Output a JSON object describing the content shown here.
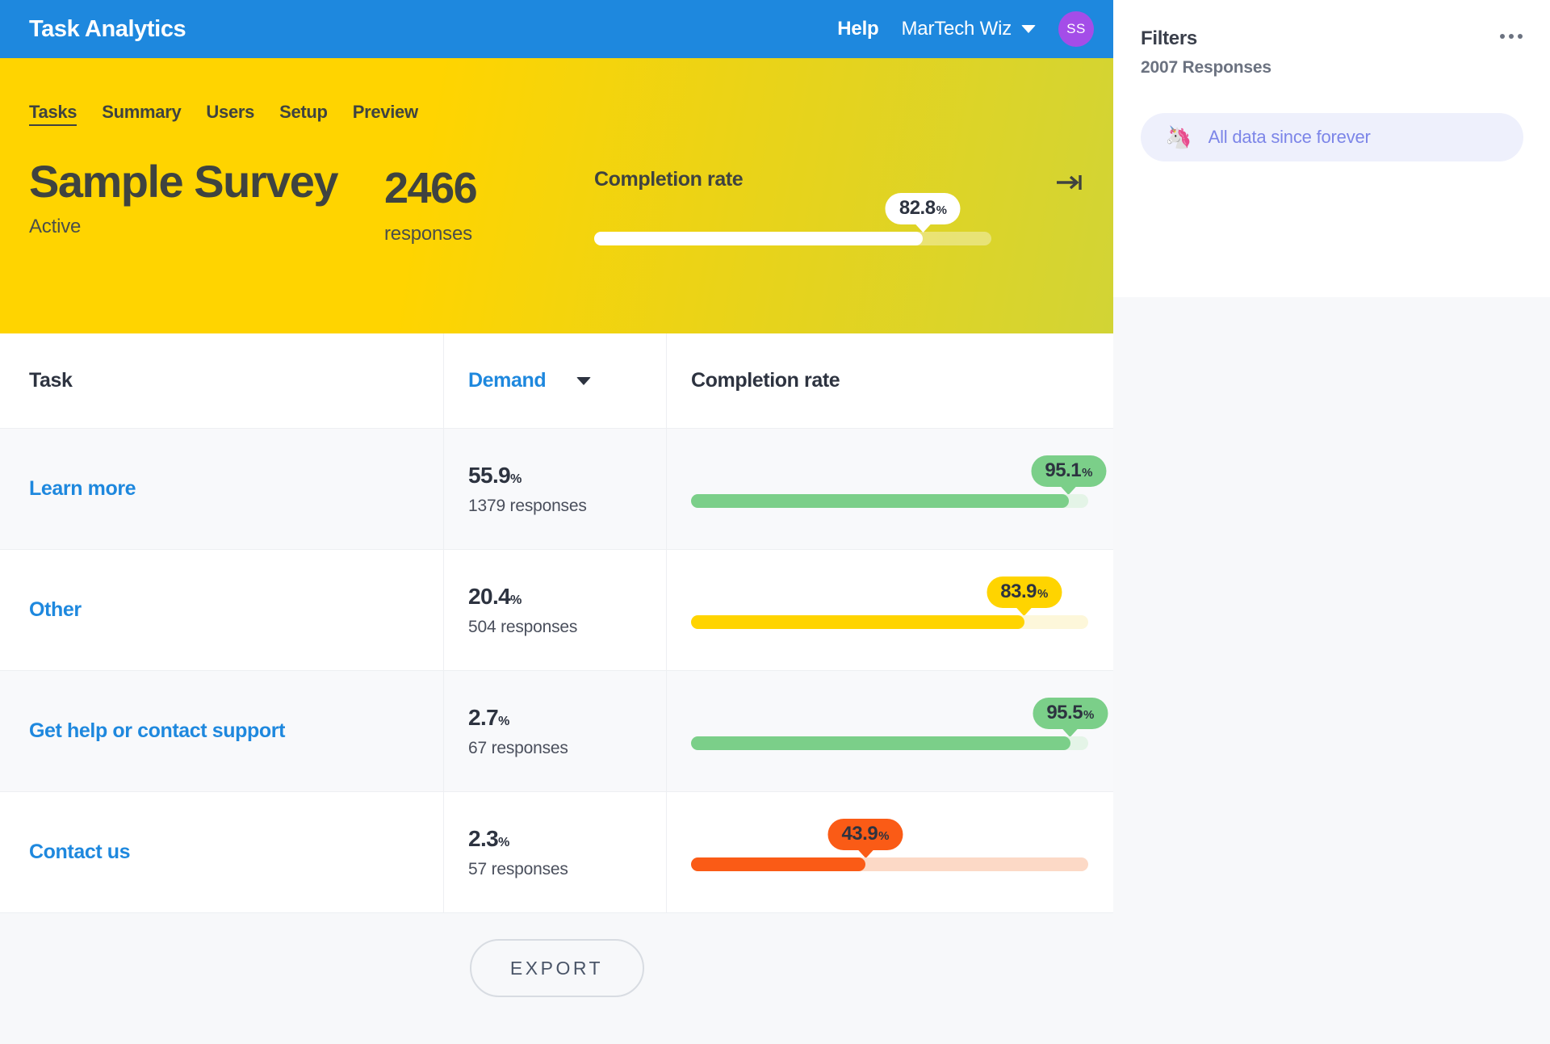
{
  "topbar": {
    "brand": "Task Analytics",
    "help_label": "Help",
    "account_name": "MarTech Wiz",
    "avatar_initials": "SS",
    "chevron_icon": "chevron-down-icon",
    "bg_color": "#1E88DE",
    "avatar_color": "#A44DE8"
  },
  "hero": {
    "tabs": [
      {
        "label": "Tasks",
        "active": true
      },
      {
        "label": "Summary",
        "active": false
      },
      {
        "label": "Users",
        "active": false
      },
      {
        "label": "Setup",
        "active": false
      },
      {
        "label": "Preview",
        "active": false
      }
    ],
    "collapse_icon": "arrow-to-end-icon",
    "title": "Sample Survey",
    "status": "Active",
    "count": "2466",
    "count_label": "responses",
    "completion_rate_label": "Completion rate",
    "completion_rate_value": 82.8,
    "completion_rate_num": "82.8",
    "completion_rate_pct": "%",
    "gradient_from": "#FFD400",
    "gradient_to": "#D2D435"
  },
  "table": {
    "headers": {
      "task": "Task",
      "demand": "Demand",
      "completion_rate": "Completion rate"
    },
    "sort_chevron_icon": "chevron-down-icon",
    "rows": [
      {
        "task": "Learn more",
        "demand_num": "55.9",
        "demand_pct": "%",
        "demand_value": 55.9,
        "responses": "1379 responses",
        "responses_count": 1379,
        "completion_num": "95.1",
        "completion_pct": "%",
        "completion_value": 95.1,
        "color": "#7BCF89",
        "track_color": "#E4F4E7"
      },
      {
        "task": "Other",
        "demand_num": "20.4",
        "demand_pct": "%",
        "demand_value": 20.4,
        "responses": "504 responses",
        "responses_count": 504,
        "completion_num": "83.9",
        "completion_pct": "%",
        "completion_value": 83.9,
        "color": "#FFD400",
        "track_color": "#FDF7DA"
      },
      {
        "task": "Get help or contact support",
        "demand_num": "2.7",
        "demand_pct": "%",
        "demand_value": 2.7,
        "responses": "67 responses",
        "responses_count": 67,
        "completion_num": "95.5",
        "completion_pct": "%",
        "completion_value": 95.5,
        "color": "#7BCF89",
        "track_color": "#E4F4E7"
      },
      {
        "task": "Contact us",
        "demand_num": "2.3",
        "demand_pct": "%",
        "demand_value": 2.3,
        "responses": "57 responses",
        "responses_count": 57,
        "completion_num": "43.9",
        "completion_pct": "%",
        "completion_value": 43.9,
        "color": "#FA5B16",
        "track_color": "#FCD9C6"
      }
    ]
  },
  "export": {
    "label": "EXPORT"
  },
  "filters": {
    "title": "Filters",
    "subtitle": "2007 Responses",
    "more_icon": "more-horizontal-icon",
    "chip": {
      "emoji": "🦄",
      "emoji_icon": "unicorn-icon",
      "label": "All data since forever"
    }
  },
  "chart_data": {
    "type": "bar",
    "title": "Task completion rate by task",
    "categories": [
      "Learn more",
      "Other",
      "Get help or contact support",
      "Contact us"
    ],
    "series": [
      {
        "name": "Demand (%)",
        "values": [
          55.9,
          20.4,
          2.7,
          2.3
        ]
      },
      {
        "name": "Completion rate (%)",
        "values": [
          95.1,
          83.9,
          95.5,
          43.9
        ]
      },
      {
        "name": "Responses",
        "values": [
          1379,
          504,
          67,
          57
        ]
      }
    ],
    "overall": {
      "responses": 2466,
      "completion_rate": 82.8,
      "filtered_responses": 2007
    },
    "xlabel": "Task",
    "ylabel": "Completion rate",
    "ylim": [
      0,
      100
    ],
    "grid": false,
    "legend": "none"
  }
}
